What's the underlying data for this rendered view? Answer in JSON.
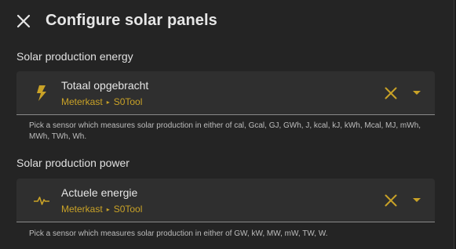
{
  "dialog": {
    "title": "Configure solar panels",
    "close_icon": "close-icon"
  },
  "energy": {
    "section_label": "Solar production energy",
    "entity_name": "Totaal opgebracht",
    "area": "Meterkast",
    "device": "S0Tool",
    "icon": "lightning-bolt-icon",
    "helper_text": "Pick a sensor which measures solar production in either of cal, Gcal, GJ, GWh, J, kcal, kJ, kWh, Mcal, MJ, mWh, MWh, TWh, Wh."
  },
  "power": {
    "section_label": "Solar production power",
    "entity_name": "Actuele energie",
    "area": "Meterkast",
    "device": "S0Tool",
    "icon": "pulse-icon",
    "helper_text": "Pick a sensor which measures solar production in either of GW, kW, MW, mW, TW, W."
  },
  "colors": {
    "accent": "#c9a227",
    "background": "#242424",
    "field_background": "#2f2f2f",
    "text": "#e6e6e6"
  }
}
